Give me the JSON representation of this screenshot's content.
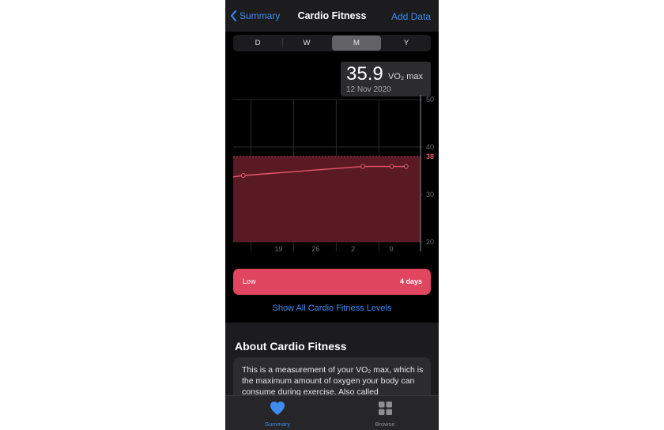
{
  "nav": {
    "back_label": "Summary",
    "title": "Cardio Fitness",
    "action_label": "Add Data"
  },
  "segments": [
    {
      "label": "D",
      "active": false
    },
    {
      "label": "W",
      "active": false
    },
    {
      "label": "M",
      "active": true
    },
    {
      "label": "Y",
      "active": false
    }
  ],
  "tooltip": {
    "value": "35.9",
    "unit": "VO₂ max",
    "date": "12 Nov 2020"
  },
  "chart_data": {
    "type": "line",
    "x_tick_labels": [
      "19",
      "26",
      "2",
      "9"
    ],
    "y_ticks": [
      20,
      30,
      40,
      50
    ],
    "ylim": [
      20,
      50
    ],
    "highlight_level": "38",
    "series": [
      {
        "x": [
          0.7,
          9,
          11,
          12
        ],
        "values": [
          34.0,
          35.9,
          35.9,
          35.9
        ]
      }
    ],
    "colors": {
      "line": "#e8566e",
      "band": "#5a1a24",
      "grid": "#2a2a2c",
      "tick": "#6e6e72",
      "highlight": "#e8566e"
    }
  },
  "level": {
    "name": "Low",
    "days": "4 days",
    "color": "#e0465f"
  },
  "show_all_label": "Show All Cardio Fitness Levels",
  "about": {
    "title": "About Cardio Fitness",
    "text": "This is a measurement of your VO₂ max, which is the maximum amount of oxygen your body can consume during exercise. Also called"
  },
  "tabs": [
    {
      "label": "Summary",
      "icon": "heart-icon",
      "active": true
    },
    {
      "label": "Browse",
      "icon": "grid-icon",
      "active": false
    }
  ]
}
